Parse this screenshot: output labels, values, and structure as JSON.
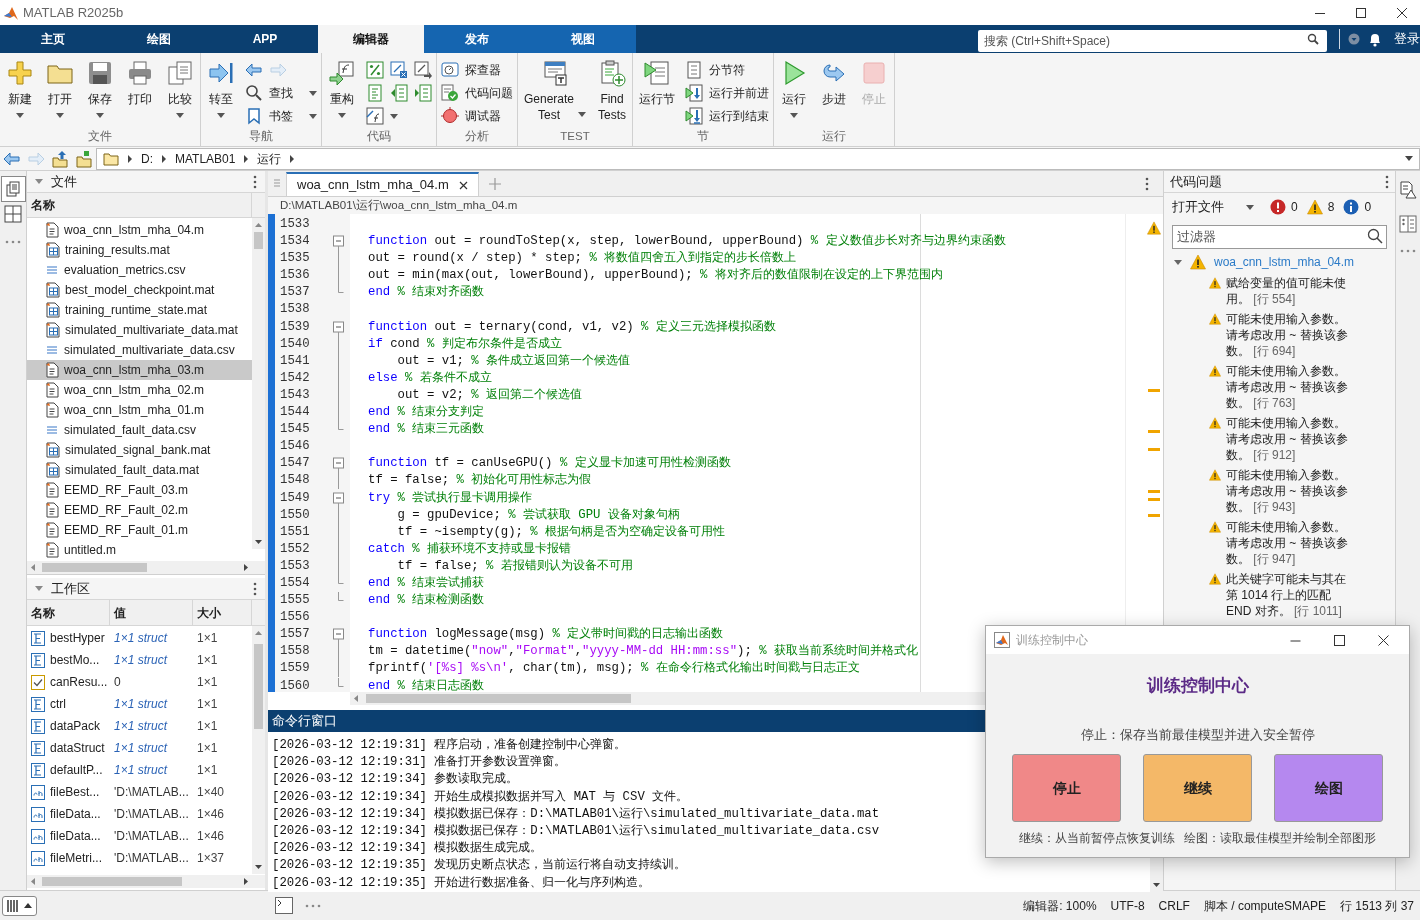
{
  "title_bar": {
    "title": "MATLAB R2025b"
  },
  "tabs": [
    {
      "label": "主页",
      "selected": false,
      "contextual": false
    },
    {
      "label": "绘图",
      "selected": false,
      "contextual": false
    },
    {
      "label": "APP",
      "selected": false,
      "contextual": false
    },
    {
      "label": "编辑器",
      "selected": true,
      "contextual": true
    },
    {
      "label": "发布",
      "selected": false,
      "contextual": true
    },
    {
      "label": "视图",
      "selected": false,
      "contextual": true
    }
  ],
  "search": {
    "placeholder": "搜索 (Ctrl+Shift+Space)"
  },
  "sign_in": "登录",
  "ribbon": {
    "groups": [
      {
        "label": "文件",
        "columns": [
          [
            {
              "kind": "large",
              "label": "新建",
              "caret": true,
              "disabled": false
            }
          ],
          [
            {
              "kind": "large",
              "label": "打开",
              "caret": true,
              "disabled": false
            }
          ],
          [
            {
              "kind": "large",
              "label": "保存",
              "caret": true,
              "disabled": false
            }
          ],
          [
            {
              "kind": "large",
              "label": "打印",
              "caret": false,
              "disabled": false
            }
          ],
          [
            {
              "kind": "large",
              "label": "比较",
              "caret": true,
              "disabled": false
            }
          ]
        ]
      },
      {
        "label": "导航",
        "columns": [
          [
            {
              "kind": "large",
              "label": "转至",
              "caret": true,
              "disabled": false
            }
          ],
          [
            {
              "kind": "icons",
              "caret": false,
              "buttons": [
                {
                  "disabled": false
                },
                {
                  "disabled": true
                }
              ]
            },
            {
              "kind": "small",
              "label": "查找",
              "caret": true
            },
            {
              "kind": "small",
              "label": "书签",
              "caret": true
            }
          ]
        ]
      },
      {
        "label": "代码",
        "columns": [
          [
            {
              "kind": "large",
              "label": "重构",
              "caret": true,
              "disabled": false
            }
          ],
          [
            {
              "kind": "icons",
              "caret": false,
              "buttons": [
                {
                  "disabled": false
                },
                {
                  "disabled": false
                },
                {
                  "disabled": false
                }
              ]
            },
            {
              "kind": "icons",
              "caret": false,
              "buttons": [
                {
                  "disabled": false
                },
                {
                  "disabled": false
                },
                {
                  "disabled": false
                }
              ]
            },
            {
              "kind": "icons",
              "caret": true,
              "buttons": [
                {
                  "disabled": false
                }
              ]
            }
          ]
        ]
      },
      {
        "label": "分析",
        "columns": [
          [
            {
              "kind": "small",
              "label": "探查器",
              "caret": false
            },
            {
              "kind": "small",
              "label": "代码问题",
              "caret": false
            },
            {
              "kind": "small",
              "label": "调试器",
              "caret": false
            }
          ]
        ]
      },
      {
        "label": "TEST",
        "columns": [
          [
            {
              "kind": "large-inline",
              "label": "Generate\nTest",
              "caret": true,
              "disabled": false
            }
          ],
          [
            {
              "kind": "large",
              "label": "Find\nTests",
              "caret": false,
              "disabled": false
            }
          ]
        ]
      },
      {
        "label": "节",
        "columns": [
          [
            {
              "kind": "large",
              "label": "运行节",
              "caret": false,
              "disabled": false
            }
          ],
          [
            {
              "kind": "small",
              "label": "分节符",
              "caret": false
            },
            {
              "kind": "small",
              "label": "运行并前进",
              "caret": false
            },
            {
              "kind": "small",
              "label": "运行到结束",
              "caret": false
            }
          ]
        ]
      },
      {
        "label": "运行",
        "columns": [
          [
            {
              "kind": "large",
              "label": "运行",
              "caret": true,
              "disabled": false
            }
          ],
          [
            {
              "kind": "large",
              "label": "步进",
              "caret": false,
              "disabled": false
            }
          ],
          [
            {
              "kind": "large",
              "label": "停止",
              "caret": false,
              "disabled": true
            }
          ]
        ]
      }
    ]
  },
  "address_bar": {
    "crumbs": [
      "D:",
      "MATLAB01",
      "运行"
    ]
  },
  "files_panel": {
    "title": "文件",
    "column": "名称",
    "items": [
      {
        "name": "woa_cnn_lstm_mha_04.m",
        "kind": "m",
        "selected": false
      },
      {
        "name": "training_results.mat",
        "kind": "mat",
        "selected": false
      },
      {
        "name": "evaluation_metrics.csv",
        "kind": "csv",
        "selected": false
      },
      {
        "name": "best_model_checkpoint.mat",
        "kind": "mat",
        "selected": false
      },
      {
        "name": "training_runtime_state.mat",
        "kind": "mat",
        "selected": false
      },
      {
        "name": "simulated_multivariate_data.mat",
        "kind": "mat",
        "selected": false
      },
      {
        "name": "simulated_multivariate_data.csv",
        "kind": "csv",
        "selected": false
      },
      {
        "name": "woa_cnn_lstm_mha_03.m",
        "kind": "m",
        "selected": true
      },
      {
        "name": "woa_cnn_lstm_mha_02.m",
        "kind": "m",
        "selected": false
      },
      {
        "name": "woa_cnn_lstm_mha_01.m",
        "kind": "m",
        "selected": false
      },
      {
        "name": "simulated_fault_data.csv",
        "kind": "csv",
        "selected": false
      },
      {
        "name": "simulated_signal_bank.mat",
        "kind": "mat",
        "selected": false
      },
      {
        "name": "simulated_fault_data.mat",
        "kind": "mat",
        "selected": false
      },
      {
        "name": "EEMD_RF_Fault_03.m",
        "kind": "m",
        "selected": false
      },
      {
        "name": "EEMD_RF_Fault_02.m",
        "kind": "m",
        "selected": false
      },
      {
        "name": "EEMD_RF_Fault_01.m",
        "kind": "m",
        "selected": false
      },
      {
        "name": "untitled.m",
        "kind": "m",
        "selected": false
      }
    ]
  },
  "workspace_panel": {
    "title": "工作区",
    "columns": [
      "名称",
      "值",
      "大小"
    ],
    "rows": [
      {
        "name": "bestHyper",
        "value": "1×1 struct",
        "size": "1×1",
        "kind": "struct"
      },
      {
        "name": "bestMo...",
        "value": "1×1 struct",
        "size": "1×1",
        "kind": "struct"
      },
      {
        "name": "canResu...",
        "value": "0",
        "size": "1×1",
        "kind": "logical"
      },
      {
        "name": "ctrl",
        "value": "1×1 struct",
        "size": "1×1",
        "kind": "struct"
      },
      {
        "name": "dataPack",
        "value": "1×1 struct",
        "size": "1×1",
        "kind": "struct"
      },
      {
        "name": "dataStruct",
        "value": "1×1 struct",
        "size": "1×1",
        "kind": "struct"
      },
      {
        "name": "defaultP...",
        "value": "1×1 struct",
        "size": "1×1",
        "kind": "struct"
      },
      {
        "name": "fileBest...",
        "value": "'D:\\MATLAB...",
        "size": "1×40",
        "kind": "char"
      },
      {
        "name": "fileData...",
        "value": "'D:\\MATLAB...",
        "size": "1×46",
        "kind": "char"
      },
      {
        "name": "fileData...",
        "value": "'D:\\MATLAB...",
        "size": "1×46",
        "kind": "char"
      },
      {
        "name": "fileMetri...",
        "value": "'D:\\MATLAB...",
        "size": "1×37",
        "kind": "char"
      }
    ]
  },
  "editor": {
    "tabs": [
      {
        "label": "woa_cnn_lstm_mha_04.m",
        "selected": true
      }
    ],
    "path": "D:\\MATLAB01\\运行\\woa_cnn_lstm_mha_04.m",
    "lines": [
      {
        "number": "1533",
        "kind": "plain"
      },
      {
        "number": "1534",
        "kind": "fold-start",
        "segments": [
          {
            "kind": "keyword",
            "text": "function"
          },
          {
            "kind": "plain",
            "text": " out = roundToStep(x, step, lowerBound, upperBound) "
          },
          {
            "kind": "comment",
            "text": "% 定义数值步长对齐与边界约束函数"
          }
        ]
      },
      {
        "number": "1535",
        "kind": "fold-body",
        "segments": [
          {
            "kind": "plain",
            "text": "out = round(x / step) * step; "
          },
          {
            "kind": "comment",
            "text": "% 将数值四舍五入到指定的步长倍数上"
          }
        ]
      },
      {
        "number": "1536",
        "kind": "fold-body",
        "segments": [
          {
            "kind": "plain",
            "text": "out = min(max(out, lowerBound), upperBound); "
          },
          {
            "kind": "comment",
            "text": "% 将对齐后的数值限制在设定的上下界范围内"
          }
        ]
      },
      {
        "number": "1537",
        "kind": "fold-end",
        "segments": [
          {
            "kind": "keyword",
            "text": "end "
          },
          {
            "kind": "comment",
            "text": "% 结束对齐函数"
          }
        ]
      },
      {
        "number": "1538",
        "kind": "plain"
      },
      {
        "number": "1539",
        "kind": "fold-start",
        "segments": [
          {
            "kind": "keyword",
            "text": "function"
          },
          {
            "kind": "plain",
            "text": " out = ternary(cond, v1, v2) "
          },
          {
            "kind": "comment",
            "text": "% 定义三元选择模拟函数"
          }
        ]
      },
      {
        "number": "1540",
        "kind": "fold-body",
        "segments": [
          {
            "kind": "keyword",
            "text": "if"
          },
          {
            "kind": "plain",
            "text": " cond "
          },
          {
            "kind": "comment",
            "text": "% 判定布尔条件是否成立"
          }
        ]
      },
      {
        "number": "1541",
        "kind": "fold-body",
        "segments": [
          {
            "kind": "plain",
            "text": "    out = v1; "
          },
          {
            "kind": "comment",
            "text": "% 条件成立返回第一个候选值"
          }
        ]
      },
      {
        "number": "1542",
        "kind": "fold-body",
        "segments": [
          {
            "kind": "keyword",
            "text": "else "
          },
          {
            "kind": "comment",
            "text": "% 若条件不成立"
          }
        ]
      },
      {
        "number": "1543",
        "kind": "fold-body",
        "segments": [
          {
            "kind": "plain",
            "text": "    out = v2; "
          },
          {
            "kind": "comment",
            "text": "% 返回第二个候选值"
          }
        ]
      },
      {
        "number": "1544",
        "kind": "fold-body",
        "segments": [
          {
            "kind": "keyword",
            "text": "end "
          },
          {
            "kind": "comment",
            "text": "% 结束分支判定"
          }
        ]
      },
      {
        "number": "1545",
        "kind": "fold-end",
        "segments": [
          {
            "kind": "keyword",
            "text": "end "
          },
          {
            "kind": "comment",
            "text": "% 结束三元函数"
          }
        ]
      },
      {
        "number": "1546",
        "kind": "plain"
      },
      {
        "number": "1547",
        "kind": "fold-start",
        "segments": [
          {
            "kind": "keyword",
            "text": "function"
          },
          {
            "kind": "plain",
            "text": " tf = canUseGPU() "
          },
          {
            "kind": "comment",
            "text": "% 定义显卡加速可用性检测函数"
          }
        ]
      },
      {
        "number": "1548",
        "kind": "fold-body",
        "segments": [
          {
            "kind": "plain",
            "text": "tf = false; "
          },
          {
            "kind": "comment",
            "text": "% 初始化可用性标志为假"
          }
        ]
      },
      {
        "number": "1549",
        "kind": "fold-start",
        "segments": [
          {
            "kind": "keyword",
            "text": "try "
          },
          {
            "kind": "comment",
            "text": "% 尝试执行显卡调用操作"
          }
        ]
      },
      {
        "number": "1550",
        "kind": "fold-body",
        "segments": [
          {
            "kind": "plain",
            "text": "    g = gpuDevice; "
          },
          {
            "kind": "comment",
            "text": "% 尝试获取 GPU 设备对象句柄"
          }
        ]
      },
      {
        "number": "1551",
        "kind": "fold-body",
        "segments": [
          {
            "kind": "plain",
            "text": "    tf = ~isempty(g); "
          },
          {
            "kind": "comment",
            "text": "% 根据句柄是否为空确定设备可用性"
          }
        ]
      },
      {
        "number": "1552",
        "kind": "fold-body",
        "segments": [
          {
            "kind": "keyword",
            "text": "catch "
          },
          {
            "kind": "comment",
            "text": "% 捕获环境不支持或显卡报错"
          }
        ]
      },
      {
        "number": "1553",
        "kind": "fold-body",
        "segments": [
          {
            "kind": "plain",
            "text": "    tf = false; "
          },
          {
            "kind": "comment",
            "text": "% 若报错则认为设备不可用"
          }
        ]
      },
      {
        "number": "1554",
        "kind": "fold-end",
        "segments": [
          {
            "kind": "keyword",
            "text": "end "
          },
          {
            "kind": "comment",
            "text": "% 结束尝试捕获"
          }
        ]
      },
      {
        "number": "1555",
        "kind": "fold-end",
        "segments": [
          {
            "kind": "keyword",
            "text": "end "
          },
          {
            "kind": "comment",
            "text": "% 结束检测函数"
          }
        ]
      },
      {
        "number": "1556",
        "kind": "plain"
      },
      {
        "number": "1557",
        "kind": "fold-start",
        "segments": [
          {
            "kind": "keyword",
            "text": "function"
          },
          {
            "kind": "plain",
            "text": " logMessage(msg) "
          },
          {
            "kind": "comment",
            "text": "% 定义带时间戳的日志输出函数"
          }
        ]
      },
      {
        "number": "1558",
        "kind": "fold-body",
        "segments": [
          {
            "kind": "plain",
            "text": "tm = datetime("
          },
          {
            "kind": "string",
            "text": "\"now\""
          },
          {
            "kind": "plain",
            "text": ","
          },
          {
            "kind": "string",
            "text": "\"Format\""
          },
          {
            "kind": "plain",
            "text": ","
          },
          {
            "kind": "string",
            "text": "\"yyyy-MM-dd HH:mm:ss\""
          },
          {
            "kind": "plain",
            "text": "); "
          },
          {
            "kind": "comment",
            "text": "% 获取当前系统时间并格式化"
          }
        ]
      },
      {
        "number": "1559",
        "kind": "fold-body",
        "segments": [
          {
            "kind": "plain",
            "text": "fprintf("
          },
          {
            "kind": "string",
            "text": "'[%s] %s\\n'"
          },
          {
            "kind": "plain",
            "text": ", char(tm), msg); "
          },
          {
            "kind": "comment",
            "text": "% 在命令行格式化输出时间戳与日志正文"
          }
        ]
      },
      {
        "number": "1560",
        "kind": "fold-end",
        "segments": [
          {
            "kind": "keyword",
            "text": "end "
          },
          {
            "kind": "comment",
            "text": "% 结束日志函数"
          }
        ]
      }
    ]
  },
  "command_window": {
    "title": "命令行窗口",
    "lines": [
      "[2026-03-12 12:19:31] 程序启动，准备创建控制中心弹窗。",
      "[2026-03-12 12:19:31] 准备打开参数设置弹窗。",
      "[2026-03-12 12:19:34] 参数读取完成。",
      "[2026-03-12 12:19:34] 开始生成模拟数据并写入 MAT 与 CSV 文件。",
      "[2026-03-12 12:19:34] 模拟数据已保存：D:\\MATLAB01\\运行\\simulated_multivariate_data.mat",
      "[2026-03-12 12:19:34] 模拟数据已保存：D:\\MATLAB01\\运行\\simulated_multivariate_data.csv",
      "[2026-03-12 12:19:34] 模拟数据生成完成。",
      "[2026-03-12 12:19:35] 发现历史断点状态，当前运行将自动支持续训。",
      "[2026-03-12 12:19:35] 开始进行数据准备、归一化与序列构造。"
    ]
  },
  "code_issues": {
    "title": "代码问题",
    "scope": "打开文件",
    "counts": [
      {
        "kind": "error",
        "count": "0"
      },
      {
        "kind": "warning",
        "count": "8"
      },
      {
        "kind": "info",
        "count": "0"
      }
    ],
    "filter_placeholder": "过滤器",
    "file": {
      "name": "woa_cnn_lstm_mha_04.m",
      "expanded": true
    },
    "issues": [
      {
        "message": "赋给变量的值可能未使用。",
        "line_ref": "[行 554]"
      },
      {
        "message": "可能未使用输入参数。请考虑改用 ~ 替换该参数。",
        "line_ref": "[行 694]"
      },
      {
        "message": "可能未使用输入参数。请考虑改用 ~ 替换该参数。",
        "line_ref": "[行 763]"
      },
      {
        "message": "可能未使用输入参数。请考虑改用 ~ 替换该参数。",
        "line_ref": "[行 912]"
      },
      {
        "message": "可能未使用输入参数。请考虑改用 ~ 替换该参数。",
        "line_ref": "[行 943]"
      },
      {
        "message": "可能未使用输入参数。请考虑改用 ~ 替换该参数。",
        "line_ref": "[行 947]"
      },
      {
        "message": "此关键字可能未与其在第 1014 行上的匹配 END 对齐。",
        "line_ref": "[行 1011]"
      }
    ]
  },
  "dialog": {
    "title": "训练控制中心",
    "heading": "训练控制中心",
    "status": "停止：保存当前最佳模型并进入安全暂停",
    "buttons": [
      {
        "label": "停止",
        "color": "#f08888"
      },
      {
        "label": "继续",
        "color": "#f4b868"
      },
      {
        "label": "绘图",
        "color": "#b588ef"
      }
    ],
    "hint": "继续：从当前暂停点恢复训练   绘图：读取最佳模型并绘制全部图形"
  },
  "status_bar": {
    "items": [
      "编辑器: 100%",
      "UTF-8",
      "CRLF",
      "脚本 / computeSMAPE",
      "行 1513 列 37"
    ]
  }
}
